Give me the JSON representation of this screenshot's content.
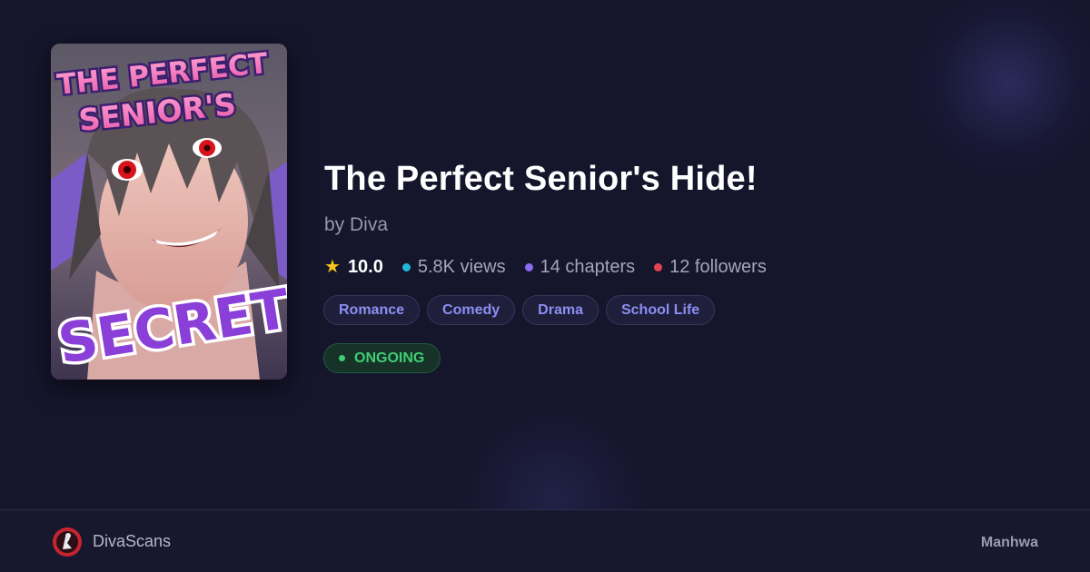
{
  "cover": {
    "art_text_line1": "THE PERFECT",
    "art_text_line2": "SENIOR'S",
    "art_text_line3": "SECRET!"
  },
  "series": {
    "title": "The Perfect Senior's Hide!",
    "author_line": "by Diva",
    "rating": "10.0",
    "views": "5.8K views",
    "chapters": "14 chapters",
    "followers": "12 followers",
    "genres": [
      "Romance",
      "Comedy",
      "Drama",
      "School Life"
    ],
    "status": "ONGOING",
    "type": "Manhwa"
  },
  "site": {
    "name": "DivaScans"
  },
  "colors": {
    "background": "#15152c",
    "rating_star": "#f5c518",
    "views_dot": "#22b8d8",
    "chapters_dot": "#8b6cf0",
    "followers_dot": "#e04550",
    "genre_text": "#8c8ef2",
    "status_green": "#3ecf73"
  },
  "icons": {
    "rating": "star-icon",
    "logo": "site-logo-icon"
  }
}
